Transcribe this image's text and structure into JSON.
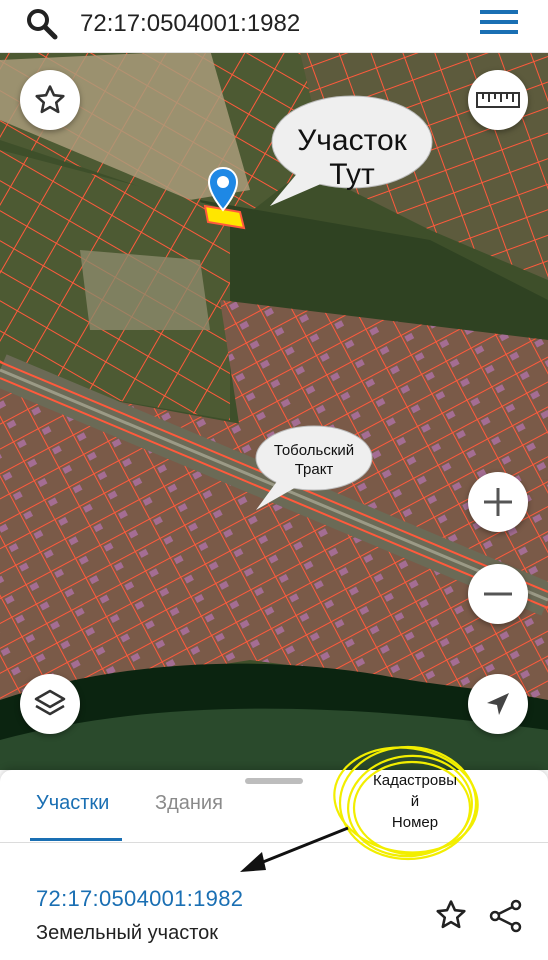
{
  "search": {
    "value": "72:17:0504001:1982",
    "placeholder": ""
  },
  "icons": {
    "search": "search-icon",
    "menu": "hamburger-menu-icon",
    "favorite": "star-outline-icon",
    "ruler": "ruler-icon",
    "layers": "layers-icon",
    "zoom_in": "plus-icon",
    "zoom_out": "minus-icon",
    "locate": "navigation-arrow-icon",
    "location_pin": "location-pin-icon",
    "share": "share-icon"
  },
  "map": {
    "callout_plot": [
      "Участок",
      "Тут"
    ],
    "callout_road": [
      "Тобольский",
      "Тракт"
    ]
  },
  "bottom_sheet": {
    "tabs": [
      {
        "label": "Участки",
        "active": true
      },
      {
        "label": "Здания",
        "active": false
      }
    ],
    "result": {
      "cadastral_number": "72:17:0504001:1982",
      "type": "Земельный участок"
    }
  },
  "annotation": {
    "lines": [
      "Кадастровы",
      "й",
      "Номер"
    ]
  },
  "colors": {
    "accent": "#1a6fb3",
    "parcel_line": "#ff5a3c",
    "pin": "#1e88e5",
    "plot_highlight": "#ffe600",
    "annotation_circle": "#f2ee00",
    "river": "#0b2410",
    "satellite_green": "#3e4f2a"
  }
}
